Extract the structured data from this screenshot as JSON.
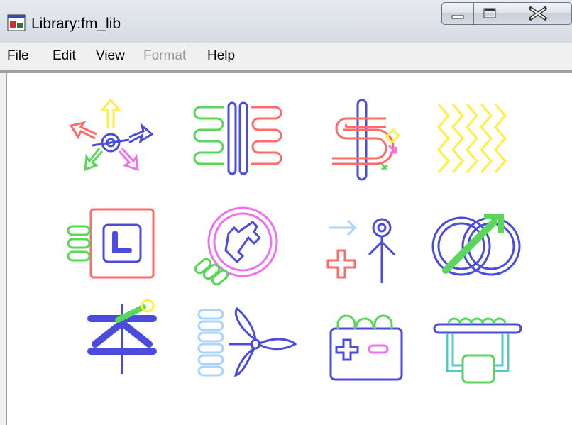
{
  "window": {
    "title": "Library:fm_lib",
    "controls": {
      "minimize": "minimize-button",
      "maximize": "maximize-button",
      "close": "close-button"
    }
  },
  "menu": {
    "items": [
      {
        "label": "File",
        "enabled": true
      },
      {
        "label": "Edit",
        "enabled": true
      },
      {
        "label": "View",
        "enabled": true
      },
      {
        "label": "Format",
        "enabled": false
      },
      {
        "label": "Help",
        "enabled": true
      }
    ]
  },
  "library": {
    "blocks": [
      {
        "icon": "arrows-motion-block-icon"
      },
      {
        "icon": "springs-block-icon"
      },
      {
        "icon": "s-path-block-icon"
      },
      {
        "icon": "waves-block-icon"
      },
      {
        "icon": "square-l-block-icon"
      },
      {
        "icon": "circle-bone-block-icon"
      },
      {
        "icon": "person-arrows-block-icon"
      },
      {
        "icon": "rings-arrow-block-icon"
      },
      {
        "icon": "tree-figure-block-icon"
      },
      {
        "icon": "coil-propeller-block-icon"
      },
      {
        "icon": "battery-block-icon"
      },
      {
        "icon": "coil-box-block-icon"
      }
    ]
  },
  "colors": {
    "red": "#ff6a6a",
    "green": "#5ad65a",
    "blue": "#4b4bdc",
    "yellow": "#ffee44",
    "magenta": "#f070f0",
    "lightblue": "#a8d4ff",
    "teal": "#55c8c8"
  }
}
